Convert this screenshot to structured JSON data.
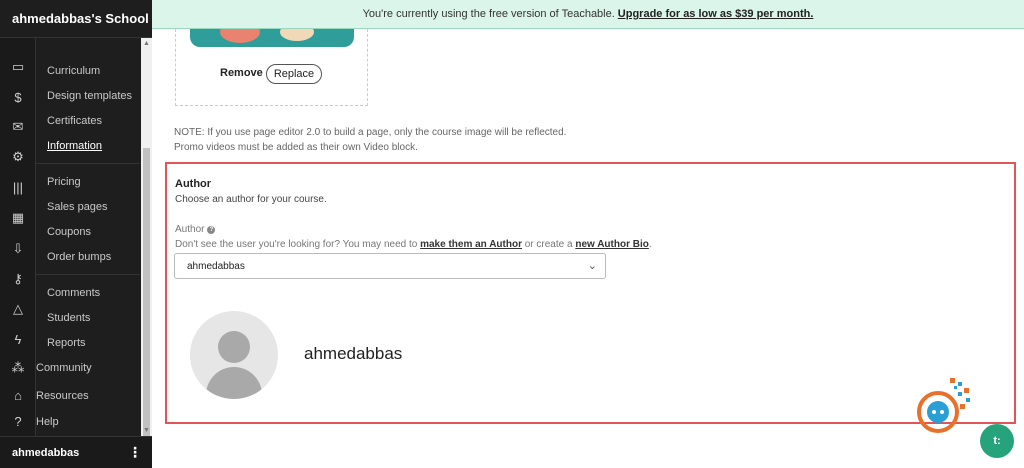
{
  "sidebar": {
    "school_name": "ahmedabbas's School",
    "rail_icons": [
      "devices-icon",
      "dollar-icon",
      "mail-icon",
      "gear-icon",
      "library-icon",
      "calendar-icon",
      "download-icon",
      "key-icon",
      "shapes-icon",
      "bolt-icon"
    ],
    "groups": [
      [
        "Curriculum",
        "Design templates",
        "Certificates",
        "Information"
      ],
      [
        "Pricing",
        "Sales pages",
        "Coupons",
        "Order bumps"
      ],
      [
        "Comments",
        "Students",
        "Reports"
      ]
    ],
    "active_item": "Information",
    "global_items": [
      {
        "label": "Community",
        "icon": "community-icon"
      },
      {
        "label": "Resources",
        "icon": "graduation-cap-icon"
      },
      {
        "label": "Help",
        "icon": "question-icon"
      }
    ],
    "user": "ahmedabbas"
  },
  "banner": {
    "text": "You're currently using the free version of Teachable.",
    "link": "Upgrade for as low as $39 per month."
  },
  "image_section": {
    "remove_label": "Remove",
    "replace_label": "Replace",
    "note_line1": "NOTE: If you use page editor 2.0 to build a page, only the course image will be reflected.",
    "note_line2": "Promo videos must be added as their own Video block."
  },
  "author": {
    "title": "Author",
    "subtitle": "Choose an author for your course.",
    "field_label": "Author",
    "hint_prefix": "Don't see the user you're looking for? You may need to",
    "hint_link1": "make them an Author",
    "hint_mid": "or create a",
    "hint_link2": "new Author Bio",
    "hint_suffix": ".",
    "selected": "ahmedabbas",
    "display_name": "ahmedabbas"
  },
  "chat_label": "t:"
}
